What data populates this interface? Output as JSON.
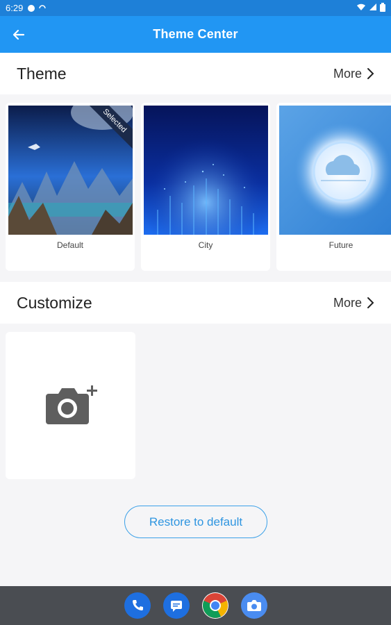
{
  "status_bar": {
    "time": "6:29"
  },
  "app_bar": {
    "title": "Theme Center"
  },
  "theme_section": {
    "title": "Theme",
    "more_label": "More",
    "themes": [
      {
        "label": "Default",
        "badge": "Selected"
      },
      {
        "label": "City"
      },
      {
        "label": "Future"
      }
    ]
  },
  "customize_section": {
    "title": "Customize",
    "more_label": "More",
    "add_icon": "camera-plus-icon"
  },
  "restore_button": {
    "label": "Restore to default"
  },
  "dock": {
    "apps": [
      "phone-icon",
      "messages-icon",
      "chrome-icon",
      "camera-icon"
    ]
  },
  "colors": {
    "accent": "#2196f3",
    "status_bar": "#1e80d8",
    "restore_border": "#3aa0e8",
    "dock": "#4a4d52"
  }
}
